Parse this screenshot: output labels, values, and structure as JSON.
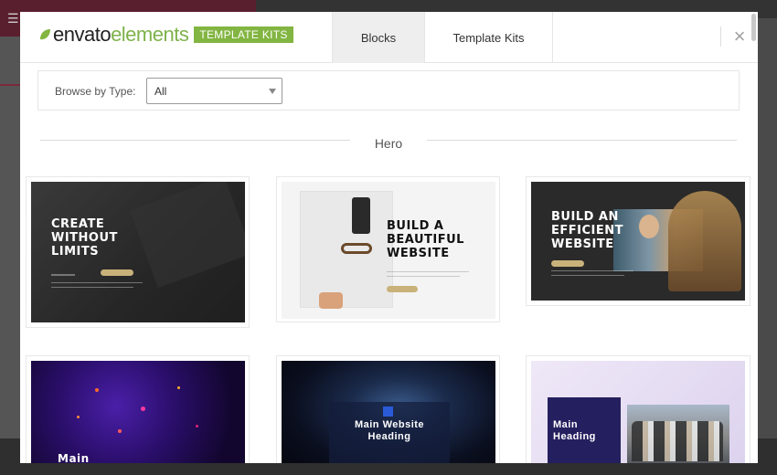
{
  "background": {
    "menu_icon": "hamburger-icon"
  },
  "header": {
    "logo": {
      "envato": "envato",
      "elements": "elements",
      "badge": "TEMPLATE KITS"
    },
    "tabs": [
      {
        "label": "Blocks",
        "active": true
      },
      {
        "label": "Template Kits",
        "active": false
      }
    ],
    "close_symbol": "×"
  },
  "filter": {
    "label": "Browse by Type:",
    "selected": "All"
  },
  "section": {
    "title": "Hero"
  },
  "cards": [
    {
      "heading": [
        "CREATE",
        "WITHOUT",
        "LIMITS"
      ]
    },
    {
      "heading": [
        "BUILD A",
        "BEAUTIFUL",
        "WEBSITE"
      ]
    },
    {
      "heading": [
        "BUILD AN",
        "EFFICIENT",
        "WEBSITE"
      ]
    },
    {
      "heading": [
        "Main"
      ]
    },
    {
      "heading": [
        "Main Website",
        "Heading"
      ]
    },
    {
      "heading": [
        "Main",
        "Heading"
      ]
    }
  ],
  "colors": {
    "brand_green": "#82b541",
    "tab_active_bg": "#eeeeee"
  }
}
